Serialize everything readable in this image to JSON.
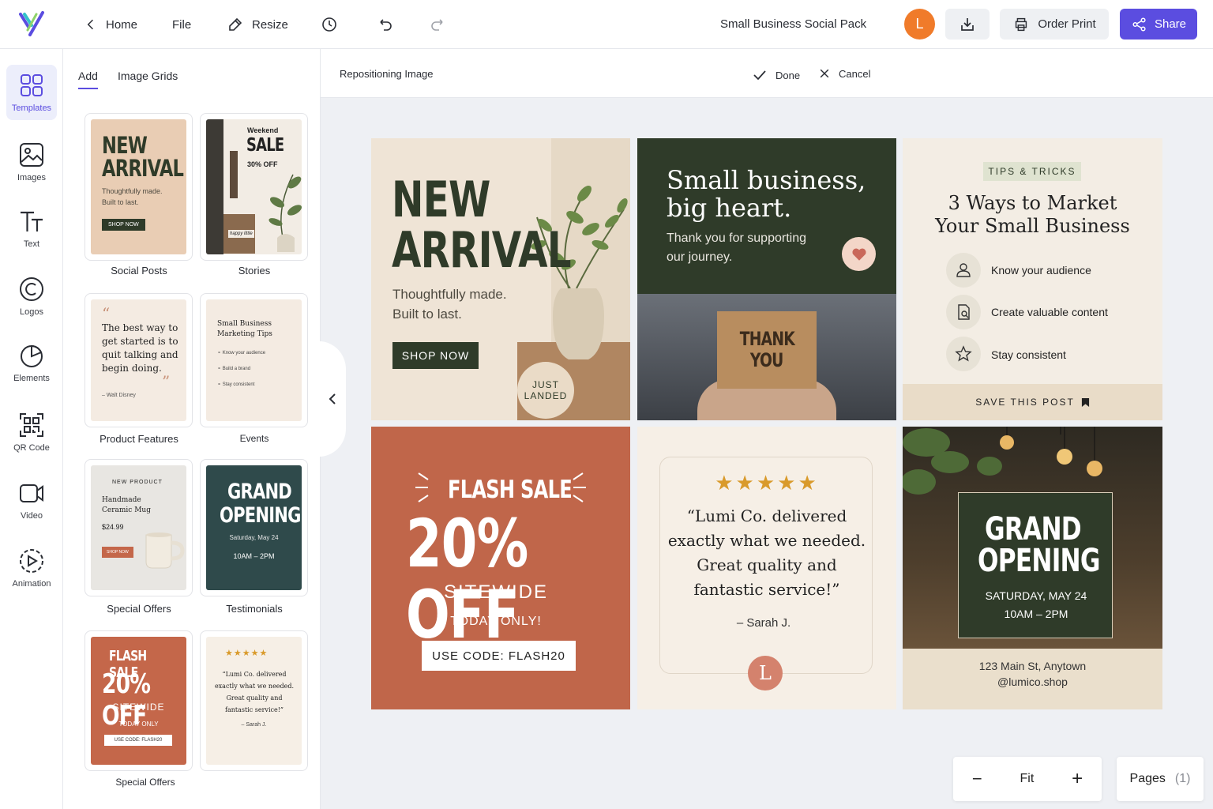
{
  "topbar": {
    "home": "Home",
    "file": "File",
    "resize": "Resize",
    "doc_title": "Small Business Social Pack",
    "avatar_initial": "L",
    "order_print": "Order Print",
    "share": "Share",
    "brand_color": "#5b4de0"
  },
  "rail": {
    "templates": "Templates",
    "images": "Images",
    "text": "Text",
    "logos": "Logos",
    "elements": "Elements",
    "qr": "QR Code",
    "video": "Video",
    "animation": "Animation"
  },
  "panel": {
    "tab_add": "Add",
    "tab_grids": "Image Grids",
    "labels": {
      "social_posts": "Social Posts",
      "stories": "Stories",
      "product_features": "Product Features",
      "events": "Events",
      "special_offers": "Special Offers",
      "testimonials": "Testimonials",
      "special_offers_2": "Special Offers"
    },
    "t1": {
      "title1": "NEW",
      "title2": "ARRIVAL",
      "line1": "Thoughtfully made.",
      "line2": "Built to last.",
      "btn": "SHOP NOW"
    },
    "t2": {
      "weekend": "Weekend",
      "sale": "SALE",
      "off": "30% OFF",
      "sign": "happy little"
    },
    "t3": {
      "quote": "The best way to get started is to quit talking and begin doing.",
      "author": "– Walt Disney"
    },
    "t4": {
      "title1": "Small Business",
      "title2": "Marketing Tips",
      "items": [
        "Know your audience",
        "Build a brand",
        "Stay consistent"
      ]
    },
    "t5": {
      "kicker": "NEW PRODUCT",
      "name1": "Handmade",
      "name2": "Ceramic Mug",
      "price": "$24.99",
      "btn": "SHOP NOW"
    },
    "t6": {
      "title1": "GRAND",
      "title2": "OPENING",
      "date": "Saturday, May 24",
      "time": "10AM – 2PM"
    },
    "t7": {
      "flash": "FLASH SALE",
      "pct": "20% OFF",
      "site": "SITEWIDE",
      "today": "TODAY ONLY",
      "code": "USE CODE: FLASH20"
    },
    "t8": {
      "stars": "★★★★★",
      "quote": "“Lumi Co. delivered exactly what we needed. Great quality and fantastic service!”",
      "author": "– Sarah J."
    }
  },
  "subbar": {
    "label": "Repositioning Image",
    "done": "Done",
    "cancel": "Cancel"
  },
  "canvas": {
    "c1": {
      "title1": "NEW",
      "title2": "ARRIVAL",
      "line1": "Thoughtfully made.",
      "line2": "Built to last.",
      "btn": "SHOP NOW",
      "badge1": "JUST",
      "badge2": "LANDED"
    },
    "c2": {
      "title1": "Small business,",
      "title2": "big heart.",
      "sub1": "Thank you for supporting",
      "sub2": "our journey.",
      "box1": "THANK",
      "box2": "YOU"
    },
    "c3": {
      "kicker": "TIPS & TRICKS",
      "title1": "3 Ways to Market",
      "title2": "Your Small Business",
      "items": [
        "Know your audience",
        "Create valuable content",
        "Stay consistent"
      ],
      "save": "SAVE THIS POST"
    },
    "c4": {
      "flash": "FLASH SALE",
      "pct": "20% OFF",
      "site": "SITEWIDE",
      "today": "TODAY ONLY!",
      "code": "USE CODE: FLASH20"
    },
    "c5": {
      "stars": "★★★★★",
      "q1": "“Lumi Co. delivered",
      "q2": "exactly what we needed.",
      "q3": "Great quality and",
      "q4": "fantastic service!”",
      "author": "– Sarah J.",
      "initial": "L"
    },
    "c6": {
      "title1": "GRAND",
      "title2": "OPENING",
      "date": "SATURDAY, MAY 24",
      "time": "10AM – 2PM",
      "addr": "123 Main St, Anytown",
      "handle": "@lumico.shop"
    }
  },
  "zoom": {
    "minus": "−",
    "fit": "Fit",
    "plus": "+"
  },
  "pages": {
    "label": "Pages",
    "count": "(1)"
  }
}
